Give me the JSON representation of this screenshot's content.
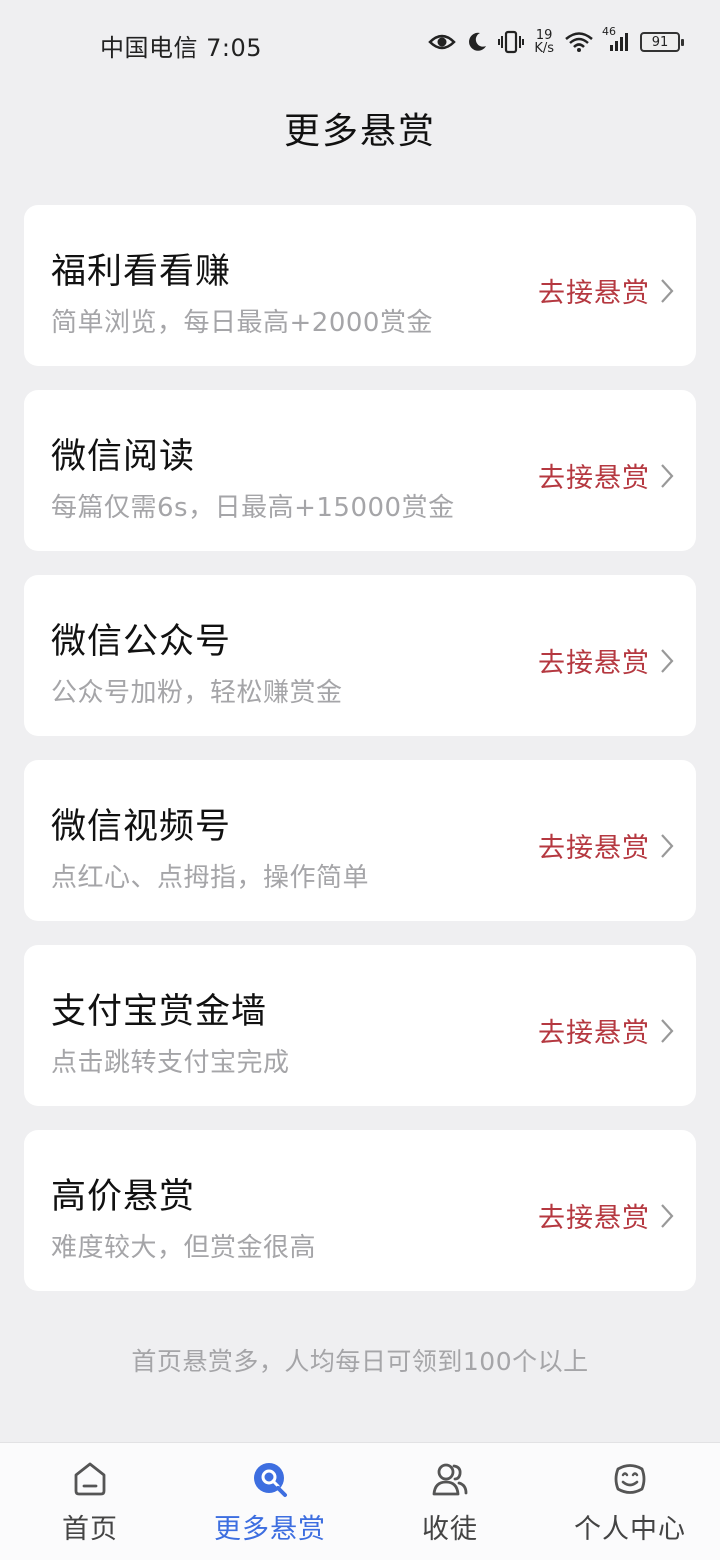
{
  "status_bar": {
    "carrier_time": "中国电信 7:05",
    "net_speed_value": "19",
    "net_speed_unit": "K/s",
    "signal_label": "46",
    "battery": "91"
  },
  "header": {
    "title": "更多悬赏"
  },
  "cards": [
    {
      "title": "福利看看赚",
      "subtitle": "简单浏览，每日最高+2000赏金",
      "action": "去接悬赏"
    },
    {
      "title": "微信阅读",
      "subtitle": "每篇仅需6s，日最高+15000赏金",
      "action": "去接悬赏"
    },
    {
      "title": "微信公众号",
      "subtitle": "公众号加粉，轻松赚赏金",
      "action": "去接悬赏"
    },
    {
      "title": "微信视频号",
      "subtitle": "点红心、点拇指，操作简单",
      "action": "去接悬赏"
    },
    {
      "title": "支付宝赏金墙",
      "subtitle": "点击跳转支付宝完成",
      "action": "去接悬赏"
    },
    {
      "title": "高价悬赏",
      "subtitle": "难度较大，但赏金很高",
      "action": "去接悬赏"
    }
  ],
  "footer_note": "首页悬赏多，人均每日可领到100个以上",
  "tabs": [
    {
      "label": "首页",
      "icon": "home-icon",
      "active": false
    },
    {
      "label": "更多悬赏",
      "icon": "search-bubble-icon",
      "active": true
    },
    {
      "label": "收徒",
      "icon": "friends-icon",
      "active": false
    },
    {
      "label": "个人中心",
      "icon": "smiley-icon",
      "active": false
    }
  ],
  "colors": {
    "background": "#efeff1",
    "card": "#ffffff",
    "action_red": "#b53840",
    "active_blue": "#3d6ee0",
    "muted_text": "#a5a5a8"
  }
}
